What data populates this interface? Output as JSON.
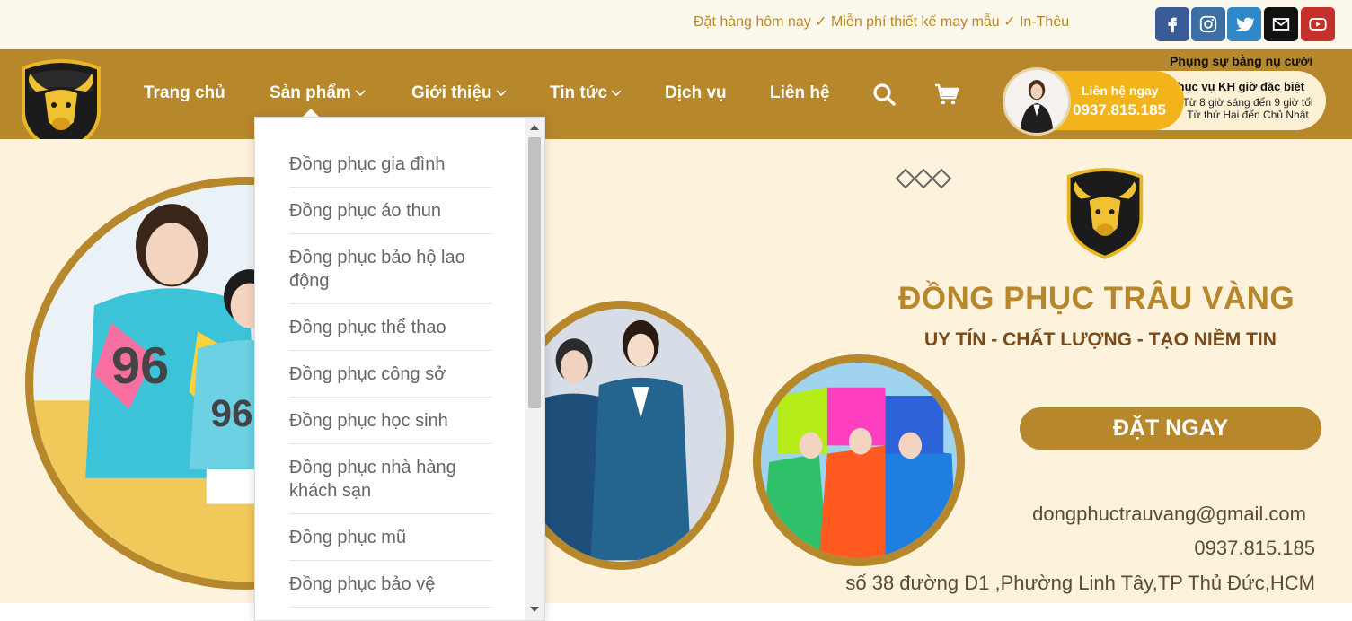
{
  "topbar": {
    "marquee_text": "Đặt hàng hôm nay ✓ Miễn phí thiết kế may mẫu ✓ In-Thêu",
    "social": [
      {
        "name": "facebook-icon",
        "color": "#3a5a98"
      },
      {
        "name": "instagram-icon",
        "color": "#3b6fa5"
      },
      {
        "name": "twitter-icon",
        "color": "#2f88c8"
      },
      {
        "name": "email-icon",
        "color": "#111111"
      },
      {
        "name": "youtube-icon",
        "color": "#c4302b"
      }
    ]
  },
  "nav": {
    "items": [
      {
        "label": "Trang chủ",
        "has_dropdown": false
      },
      {
        "label": "Sản phẩm",
        "has_dropdown": true
      },
      {
        "label": "Giới thiệu",
        "has_dropdown": true
      },
      {
        "label": "Tin tức",
        "has_dropdown": true
      },
      {
        "label": "Dịch vụ",
        "has_dropdown": false
      },
      {
        "label": "Liên hệ",
        "has_dropdown": false
      }
    ],
    "search_icon": "search-icon",
    "cart_icon": "cart-icon"
  },
  "contact": {
    "slogan": "Phụng sự bằng nụ cười",
    "call_label": "Liên hệ ngay",
    "phone": "0937.815.185",
    "hours_title": "Phục vụ KH giờ đặc biệt",
    "hours_line1": "Từ 8 giờ sáng đến 9 giờ tối",
    "hours_line2": "Từ thứ Hai đến Chủ Nhật"
  },
  "dropdown": {
    "items": [
      "Đồng phục gia đình",
      "Đồng phục áo thun",
      "Đồng phục bảo hộ lao động",
      "Đồng phục thể thao",
      "Đồng phục công sở",
      "Đồng phục học sinh",
      "Đồng phục nhà hàng khách sạn",
      "Đồng phục mũ",
      "Đồng phục bảo vệ"
    ]
  },
  "banner": {
    "brand_name": "ĐỒNG PHỤC TRÂU VÀNG",
    "tagline": "UY TÍN - CHẤT LƯỢNG - TẠO NIỀM TIN",
    "cta_label": "ĐẶT NGAY",
    "email": "dongphuctrauvang@gmail.com",
    "phone": "0937.815.185",
    "address": "số 38 đường D1 ,Phường Linh Tây,TP Thủ Đức,HCM",
    "logo_text": "ĐỒNG PHỤC TRÂU VÀNG"
  },
  "colors": {
    "brand_gold": "#b7872c",
    "accent_yellow": "#f2b31b",
    "banner_bg": "#fdf2dc"
  }
}
